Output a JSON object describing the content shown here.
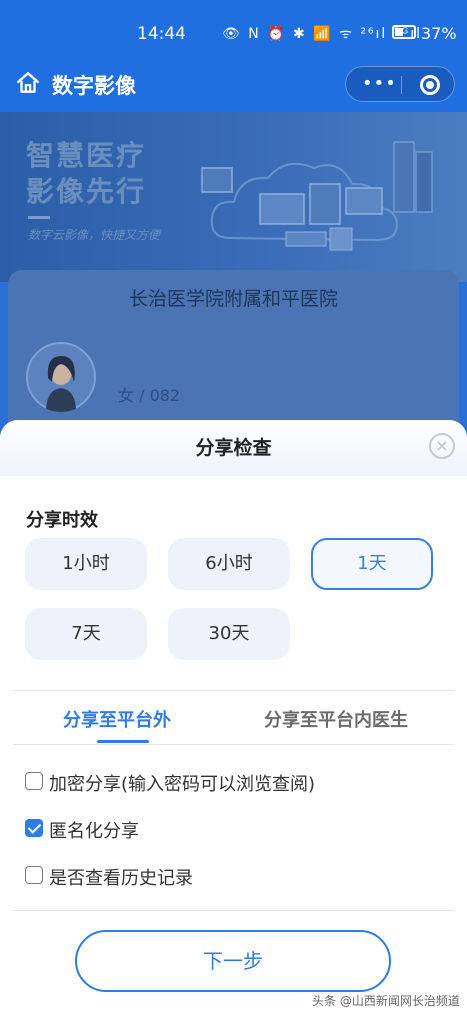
{
  "status_bar": {
    "time": "14:44",
    "icons": "👁 N ⏰ ✱ 📶 ᯤ ²⁶ıl ⁵ᴳıl",
    "battery_percent": "37%"
  },
  "nav": {
    "title": "数字影像",
    "more_label": "•••"
  },
  "banner": {
    "headline_1": "智慧医疗",
    "headline_2": "影像先行",
    "subtitle": "数字云影像，快捷又方便"
  },
  "card": {
    "hospital_name": "长治医学院附属和平医院",
    "patient_info": "女 / 082"
  },
  "sheet": {
    "title": "分享检查",
    "close_label": "×",
    "duration_label": "分享时效",
    "durations": [
      "1小时",
      "6小时",
      "1天",
      "7天",
      "30天"
    ],
    "selected_duration": "1天",
    "tabs": [
      "分享至平台外",
      "分享至平台内医生"
    ],
    "active_tab": "分享至平台外",
    "options": [
      {
        "label": "加密分享(输入密码可以浏览查阅)",
        "checked": false
      },
      {
        "label": "匿名化分享",
        "checked": true
      },
      {
        "label": "是否查看历史记录",
        "checked": false
      }
    ],
    "next_label": "下一步"
  },
  "watermark": "头条 @山西新闻网长治频道",
  "colors": {
    "primary": "#2f7be8",
    "nav_bg": "#1f6fe0"
  }
}
